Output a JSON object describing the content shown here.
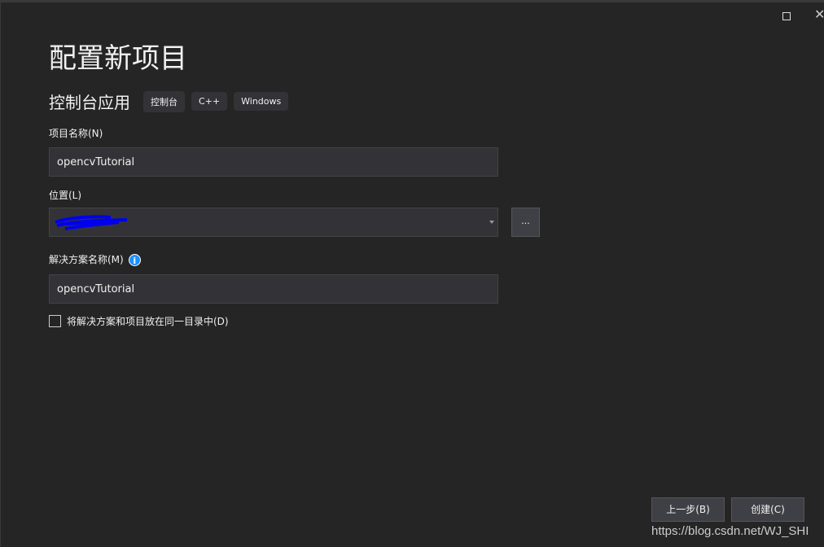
{
  "window": {
    "maximize_icon": "square",
    "close_icon": "x"
  },
  "title": "配置新项目",
  "template": {
    "name": "控制台应用",
    "tags": [
      "控制台",
      "C++",
      "Windows"
    ]
  },
  "project_name": {
    "label": "项目名称(N)",
    "value": "opencvTutorial"
  },
  "location": {
    "label": "位置(L)",
    "browse_label": "..."
  },
  "solution_name": {
    "label": "解决方案名称(M)",
    "value": "opencvTutorial",
    "info_icon": "i"
  },
  "same_dir": {
    "label": "将解决方案和项目放在同一目录中(D)",
    "checked": false
  },
  "buttons": {
    "back": "上一步(B)",
    "create": "创建(C)"
  },
  "watermark": "https://blog.csdn.net/WJ_SHI"
}
